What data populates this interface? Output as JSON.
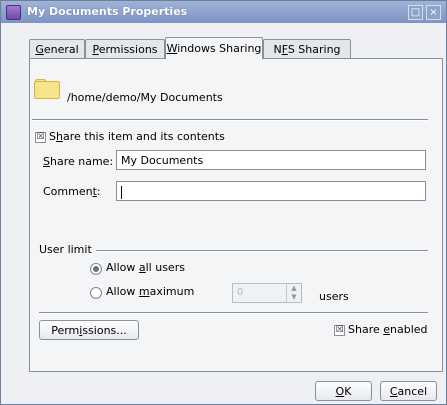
{
  "window": {
    "title": "My Documents Properties",
    "minimize_glyph": "□",
    "close_glyph": "×",
    "app_icon": "folder-properties-icon"
  },
  "tabs": [
    {
      "label_pre": "",
      "mnemonic": "G",
      "label_post": "eneral"
    },
    {
      "label_pre": "",
      "mnemonic": "P",
      "label_post": "ermissions"
    },
    {
      "label_pre": "",
      "mnemonic": "W",
      "label_post": "indows Sharing"
    },
    {
      "label_pre": "N",
      "mnemonic": "F",
      "label_post": "S Sharing"
    }
  ],
  "active_tab": "Windows Sharing",
  "folder": {
    "icon": "folder-icon",
    "path": "/home/demo/My Documents"
  },
  "share_item": {
    "checked_glyph": "☒",
    "label_pre": "S",
    "mnemonic": "h",
    "label_post": "are this item and its contents"
  },
  "share_name": {
    "label_pre": "",
    "mnemonic": "S",
    "label_post": "hare name:",
    "value": "My Documents"
  },
  "comment": {
    "label_pre": "Commen",
    "mnemonic": "t",
    "label_post": ":",
    "value": ""
  },
  "user_limit": {
    "group_label": "User limit",
    "allow_all": {
      "label_pre": "Allow ",
      "mnemonic": "a",
      "label_post": "ll users",
      "selected": true
    },
    "allow_max": {
      "label_pre": "Allow ",
      "mnemonic": "m",
      "label_post": "aximum",
      "selected": false
    },
    "max_value": "0",
    "users_label": "users"
  },
  "permissions_button": {
    "label_pre": "Perm",
    "mnemonic": "i",
    "label_post": "ssions..."
  },
  "share_enabled": {
    "checked_glyph": "☒",
    "label_pre": "Share ",
    "mnemonic": "e",
    "label_post": "nabled"
  },
  "ok_button": {
    "label_pre": "",
    "mnemonic": "O",
    "label_post": "K"
  },
  "cancel_button": {
    "label_pre": "",
    "mnemonic": "C",
    "label_post": "ancel"
  }
}
